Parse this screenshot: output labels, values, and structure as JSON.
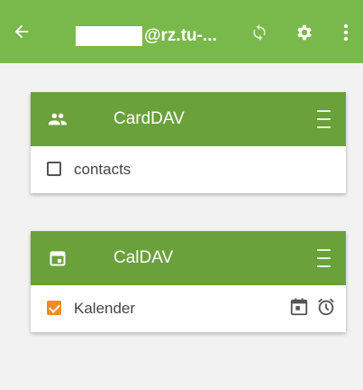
{
  "appbar": {
    "account_suffix": "@rz.tu-...",
    "background": "#79b84a"
  },
  "cards": [
    {
      "title": "CardDAV",
      "icon": "contacts-group-icon",
      "header_color": "#6aa13b",
      "items": [
        {
          "label": "contacts",
          "checked": false
        }
      ]
    },
    {
      "title": "CalDAV",
      "icon": "calendar-icon",
      "header_color": "#6aa13b",
      "items": [
        {
          "label": "Kalender",
          "checked": true,
          "accent": "#f28c28",
          "icons": [
            "calendar-event-icon",
            "alarm-clock-icon"
          ]
        }
      ]
    }
  ]
}
